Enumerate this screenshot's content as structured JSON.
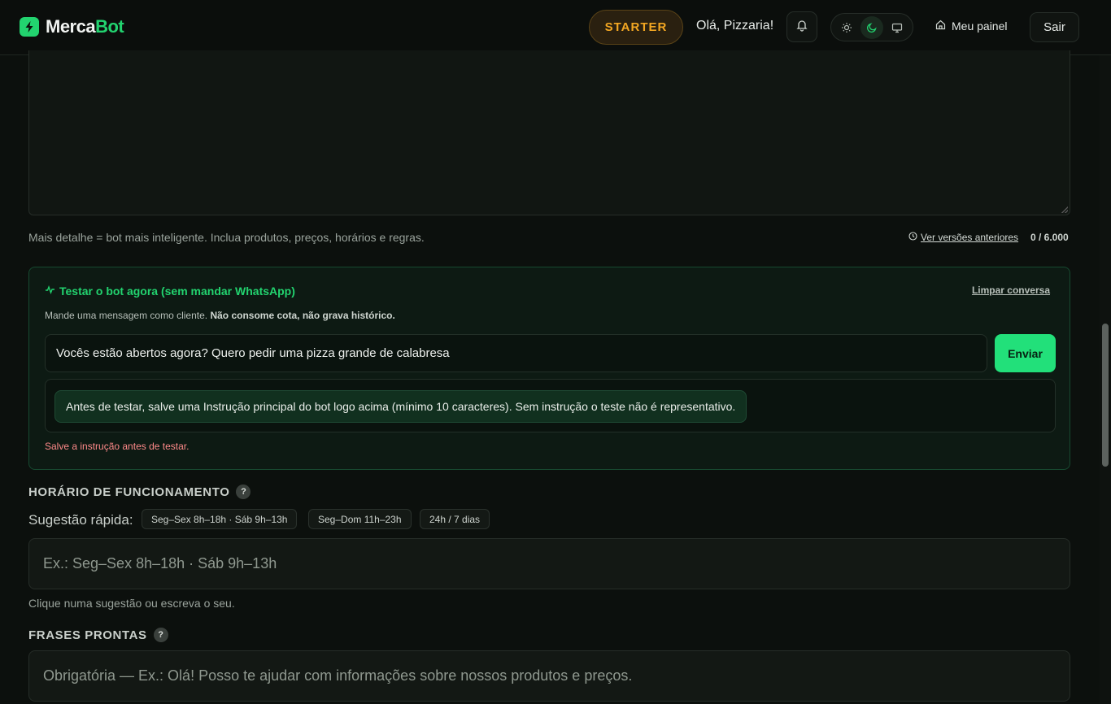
{
  "header": {
    "brand_part1": "Merca",
    "brand_part2": "Bot",
    "plan": "STARTER",
    "greeting": "Olá, Pizzaria!",
    "panel_link": "Meu painel",
    "logout": "Sair",
    "accent": "#22d36f"
  },
  "instruction": {
    "hint": "Mais detalhe = bot mais inteligente. Inclua produtos, preços, horários e regras.",
    "versions_link": "Ver versões anteriores",
    "char_count": "0 / 6.000"
  },
  "test": {
    "title": "Testar o bot agora (sem mandar WhatsApp)",
    "clear": "Limpar conversa",
    "subtitle_plain": "Mande uma mensagem como cliente.",
    "subtitle_bold": "Não consome cota, não grava histórico.",
    "message_value": "Vocês estão abertos agora? Quero pedir uma pizza grande de calabresa",
    "send": "Enviar",
    "bot_reply": "Antes de testar, salve uma Instrução principal do bot logo acima (mínimo 10 caracteres). Sem instrução o teste não é representativo.",
    "error": "Salve a instrução antes de testar."
  },
  "hours": {
    "heading": "HORÁRIO DE FUNCIONAMENTO",
    "suggest_label": "Sugestão rápida:",
    "chips": [
      "Seg–Sex 8h–18h · Sáb 9h–13h",
      "Seg–Dom 11h–23h",
      "24h / 7 dias"
    ],
    "placeholder": "Ex.: Seg–Sex 8h–18h · Sáb 9h–13h",
    "help": "Clique numa sugestão ou escreva o seu."
  },
  "phrases": {
    "heading": "FRASES PRONTAS",
    "placeholder": "Obrigatória — Ex.: Olá! Posso te ajudar com informações sobre nossos produtos e preços."
  },
  "help_mark": "?"
}
